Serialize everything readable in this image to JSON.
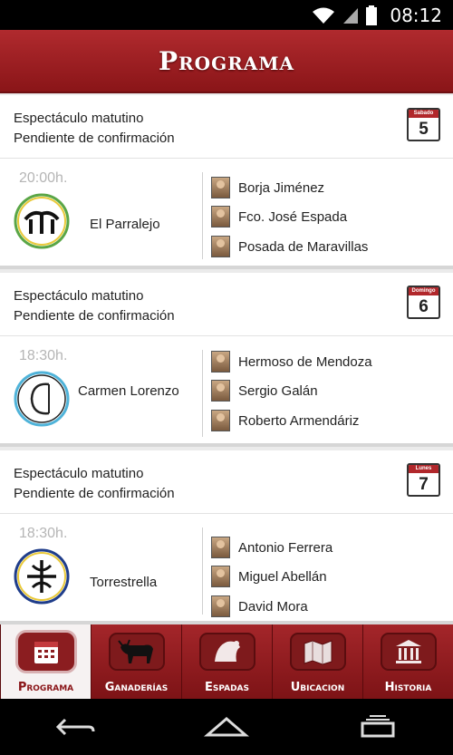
{
  "status": {
    "time": "08:12"
  },
  "header": {
    "title": "Programa"
  },
  "events": [
    {
      "line1": "Espectáculo matutino",
      "line2": "Pendiente de confirmación",
      "calendar": {
        "weekday": "Sabado",
        "day": "5"
      },
      "time": "20:00h.",
      "venue": "El Parralejo",
      "logo_color": "#5aa646",
      "toreros": [
        "Borja Jiménez",
        "Fco. José Espada",
        "Posada de Maravillas"
      ]
    },
    {
      "line1": "Espectáculo matutino",
      "line2": "Pendiente de confirmación",
      "calendar": {
        "weekday": "Domingo",
        "day": "6"
      },
      "time": "18:30h.",
      "venue": "Carmen Lorenzo",
      "logo_color": "#4fb3d9",
      "toreros": [
        "Hermoso de Mendoza",
        "Sergio Galán",
        "Roberto Armendáriz"
      ]
    },
    {
      "line1": "Espectáculo matutino",
      "line2": "Pendiente de confirmación",
      "calendar": {
        "weekday": "Lunes",
        "day": "7"
      },
      "time": "18:30h.",
      "venue": "Torrestrella",
      "logo_color": "#1f3d8a",
      "toreros": [
        "Antonio Ferrera",
        "Miguel Abellán",
        "David Mora"
      ]
    }
  ],
  "tabs": [
    {
      "label": "Programa",
      "icon": "calendar-icon",
      "active": true
    },
    {
      "label": "Ganaderías",
      "icon": "bull-icon",
      "active": false
    },
    {
      "label": "Espadas",
      "icon": "cape-icon",
      "active": false
    },
    {
      "label": "Ubicacion",
      "icon": "map-icon",
      "active": false
    },
    {
      "label": "Historia",
      "icon": "temple-icon",
      "active": false
    }
  ],
  "colors": {
    "brand": "#8a1518",
    "accent": "#b1272b"
  }
}
